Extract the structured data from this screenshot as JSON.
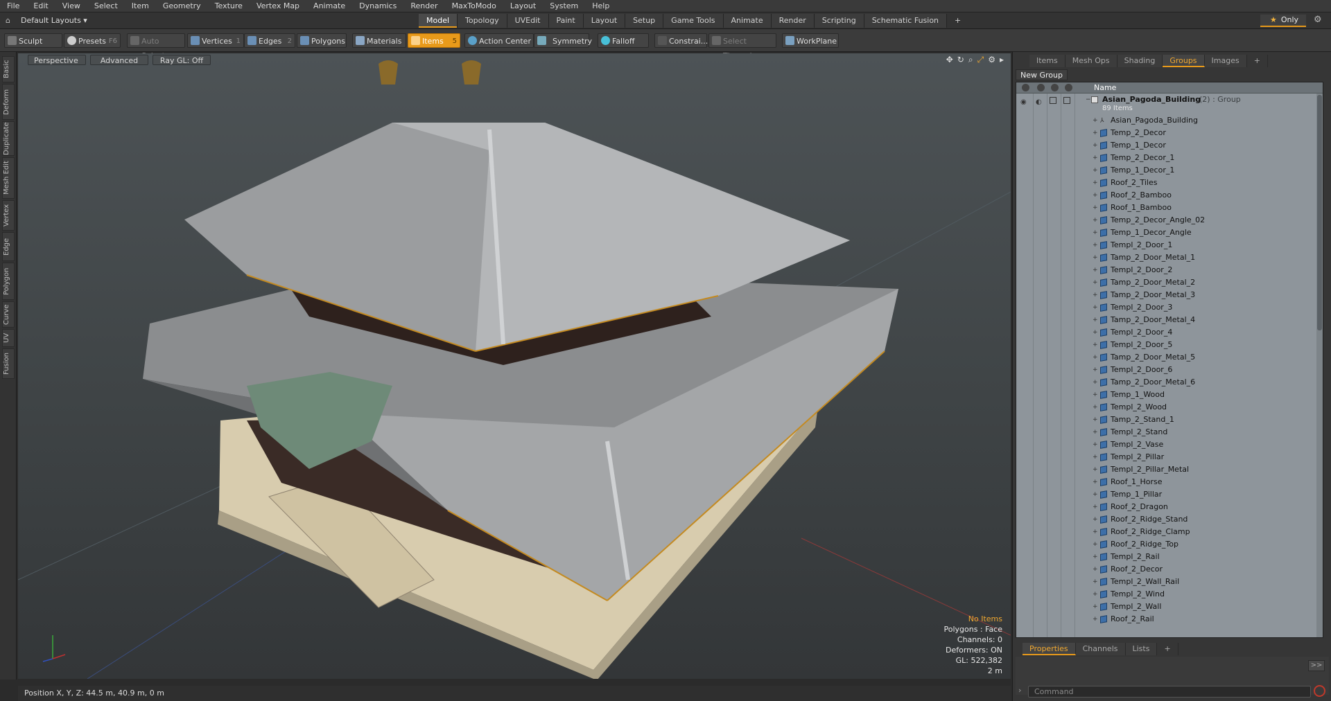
{
  "menu": [
    "File",
    "Edit",
    "View",
    "Select",
    "Item",
    "Geometry",
    "Texture",
    "Vertex Map",
    "Animate",
    "Dynamics",
    "Render",
    "MaxToModo",
    "Layout",
    "System",
    "Help"
  ],
  "layout_dropdown": "Default Layouts ▾",
  "layout_tabs": [
    {
      "label": "Model",
      "active": true
    },
    {
      "label": "Topology"
    },
    {
      "label": "UVEdit"
    },
    {
      "label": "Paint"
    },
    {
      "label": "Layout"
    },
    {
      "label": "Setup"
    },
    {
      "label": "Game Tools"
    },
    {
      "label": "Animate"
    },
    {
      "label": "Render"
    },
    {
      "label": "Scripting"
    },
    {
      "label": "Schematic Fusion"
    }
  ],
  "add_tab": "+",
  "only_label": "Only",
  "toolbar": {
    "sculpt": "Sculpt",
    "presets": "Presets",
    "presets_key": "F6",
    "auto_select": "Auto Select",
    "vertices": "Vertices",
    "vertices_num": "1",
    "edges": "Edges",
    "edges_num": "2",
    "polygons": "Polygons",
    "materials": "Materials",
    "items": "Items",
    "items_num": "5",
    "action_center": "Action Center",
    "symmetry": "Symmetry",
    "falloff": "Falloff",
    "constrain": "Constrai...",
    "select_through": "Select Through",
    "workplane": "WorkPlane"
  },
  "left_tabs": [
    "Basic",
    "Deform",
    "Duplicate",
    "Mesh Edit",
    "Vertex",
    "Edge",
    "Polygon",
    "Curve",
    "UV",
    "Fusion"
  ],
  "viewport": {
    "view_mode": "Perspective",
    "shading": "Advanced",
    "raygl": "Ray GL: Off",
    "info": {
      "no_items": "No Items",
      "polygons": "Polygons : Face",
      "channels": "Channels: 0",
      "deformers": "Deformers: ON",
      "gl": "GL: 522,382",
      "scale": "2 m"
    }
  },
  "status": "Position X, Y, Z:   44.5 m, 40.9 m, 0 m",
  "right_panel": {
    "tabs": [
      {
        "label": "Items"
      },
      {
        "label": "Mesh Ops"
      },
      {
        "label": "Shading"
      },
      {
        "label": "Groups",
        "active": true
      },
      {
        "label": "Images"
      }
    ],
    "new_group": "New Group",
    "name_header": "Name",
    "group_name": "Asian_Pagoda_Building",
    "group_suffix": "(2) : Group",
    "group_count": "89 Items",
    "items": [
      "Asian_Pagoda_Building",
      "Temp_2_Decor",
      "Temp_1_Decor",
      "Temp_2_Decor_1",
      "Temp_1_Decor_1",
      "Roof_2_Tiles",
      "Roof_2_Bamboo",
      "Roof_1_Bamboo",
      "Temp_2_Decor_Angle_02",
      "Temp_1_Decor_Angle",
      "Templ_2_Door_1",
      "Tamp_2_Door_Metal_1",
      "Templ_2_Door_2",
      "Tamp_2_Door_Metal_2",
      "Tamp_2_Door_Metal_3",
      "Templ_2_Door_3",
      "Tamp_2_Door_Metal_4",
      "Templ_2_Door_4",
      "Templ_2_Door_5",
      "Tamp_2_Door_Metal_5",
      "Templ_2_Door_6",
      "Tamp_2_Door_Metal_6",
      "Temp_1_Wood",
      "Templ_2_Wood",
      "Tamp_2_Stand_1",
      "Templ_2_Stand",
      "Templ_2_Vase",
      "Templ_2_Pillar",
      "Templ_2_Pillar_Metal",
      "Roof_1_Horse",
      "Temp_1_Pillar",
      "Roof_2_Dragon",
      "Roof_2_Ridge_Stand",
      "Roof_2_Ridge_Clamp",
      "Roof_2_Ridge_Top",
      "Templ_2_Rail",
      "Roof_2_Decor",
      "Templ_2_Wall_Rail",
      "Templ_2_Wind",
      "Templ_2_Wall",
      "Roof_2_Rail"
    ],
    "prop_tabs": [
      {
        "label": "Properties",
        "active": true
      },
      {
        "label": "Channels"
      },
      {
        "label": "Lists"
      }
    ],
    "command_placeholder": "Command",
    "expand": ">>"
  },
  "colors": {
    "accent": "#e89a1a",
    "tree_bg": "#8e959b",
    "viewport_bg": "#4d5356"
  }
}
